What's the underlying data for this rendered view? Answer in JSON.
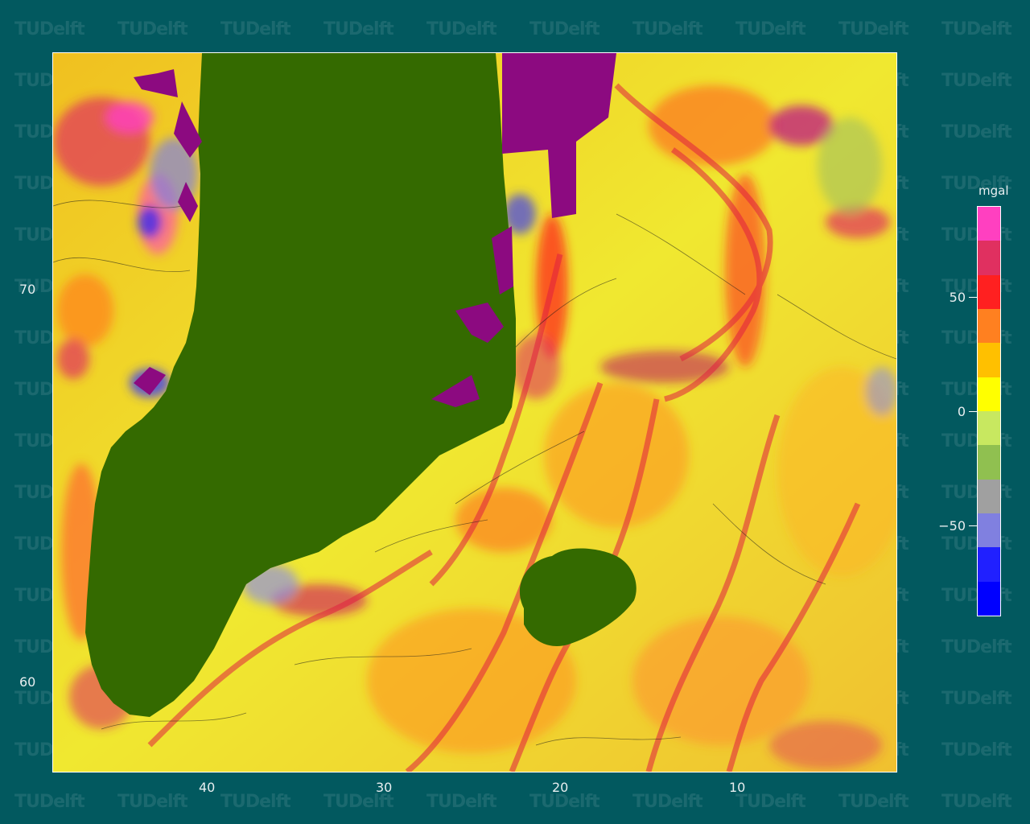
{
  "watermark": {
    "text": "TUDelft"
  },
  "map": {
    "land_color": "#346a00",
    "ice_mask_color": "#8c0a80",
    "ocean_base_color": "#e8f020"
  },
  "axes": {
    "x_ticks": [
      "40",
      "30",
      "20",
      "10"
    ],
    "y_ticks": [
      "70",
      "60"
    ]
  },
  "colorbar": {
    "unit": "mgal",
    "labels": [
      "50",
      "0",
      "−50"
    ],
    "colors": [
      "#ff40c0",
      "#e03060",
      "#ff2020",
      "#ff8020",
      "#ffc000",
      "#ffff00",
      "#c8e860",
      "#90c050",
      "#a0a0a0",
      "#8080e0",
      "#2020ff",
      "#0000ff"
    ]
  }
}
